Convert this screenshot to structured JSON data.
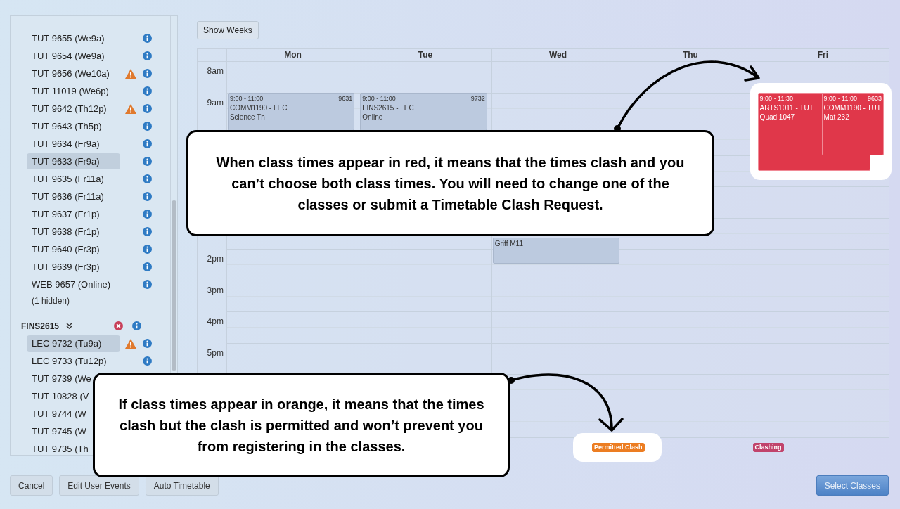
{
  "sidebar": {
    "items": [
      {
        "kind": "class",
        "label": "TUT 9655 (We9a)",
        "warning": false,
        "selected": false
      },
      {
        "kind": "class",
        "label": "TUT 9654 (We9a)",
        "warning": false,
        "selected": false
      },
      {
        "kind": "class",
        "label": "TUT 9656 (We10a)",
        "warning": true,
        "selected": false
      },
      {
        "kind": "class",
        "label": "TUT 11019 (We6p)",
        "warning": false,
        "selected": false
      },
      {
        "kind": "class",
        "label": "TUT 9642 (Th12p)",
        "warning": true,
        "selected": false
      },
      {
        "kind": "class",
        "label": "TUT 9643 (Th5p)",
        "warning": false,
        "selected": false
      },
      {
        "kind": "class",
        "label": "TUT 9634 (Fr9a)",
        "warning": false,
        "selected": false
      },
      {
        "kind": "class",
        "label": "TUT 9633 (Fr9a)",
        "warning": false,
        "selected": true
      },
      {
        "kind": "class",
        "label": "TUT 9635 (Fr11a)",
        "warning": false,
        "selected": false
      },
      {
        "kind": "class",
        "label": "TUT 9636 (Fr11a)",
        "warning": false,
        "selected": false
      },
      {
        "kind": "class",
        "label": "TUT 9637 (Fr1p)",
        "warning": false,
        "selected": false
      },
      {
        "kind": "class",
        "label": "TUT 9638 (Fr1p)",
        "warning": false,
        "selected": false
      },
      {
        "kind": "class",
        "label": "TUT 9640 (Fr3p)",
        "warning": false,
        "selected": false
      },
      {
        "kind": "class",
        "label": "TUT 9639 (Fr3p)",
        "warning": false,
        "selected": false
      },
      {
        "kind": "class",
        "label": "WEB 9657 (Online)",
        "warning": false,
        "selected": false
      },
      {
        "kind": "note",
        "label": "(1 hidden)"
      },
      {
        "kind": "course",
        "label": "FINS2615",
        "error": true
      },
      {
        "kind": "class",
        "label": "LEC 9732 (Tu9a)",
        "warning": true,
        "selected": true
      },
      {
        "kind": "class",
        "label": "LEC 9733 (Tu12p)",
        "warning": false,
        "selected": false
      },
      {
        "kind": "covered",
        "label": "TUT 9739 (We"
      },
      {
        "kind": "covered",
        "label": "TUT 10828 (V"
      },
      {
        "kind": "covered",
        "label": "TUT 9744 (W"
      },
      {
        "kind": "covered",
        "label": "TUT 9745 (W"
      },
      {
        "kind": "covered",
        "label": "TUT 9735 (Th"
      }
    ]
  },
  "show_weeks_button": "Show Weeks",
  "calendar": {
    "time_rows": [
      "8am",
      "9am",
      null,
      null,
      null,
      null,
      "2pm",
      "3pm",
      "4pm",
      "5pm",
      null,
      null
    ],
    "days": [
      {
        "name": "Mon",
        "highlight": false,
        "events": [
          {
            "time": "9:00 - 11:00",
            "number": "9631",
            "title": "COMM1190 - LEC",
            "location": "Science Th",
            "clash": false
          }
        ]
      },
      {
        "name": "Tue",
        "highlight": false,
        "events": [
          {
            "time": "9:00 - 11:00",
            "number": "9732",
            "title": "FINS2615 - LEC",
            "location": "Online",
            "clash": false
          }
        ]
      },
      {
        "name": "Wed",
        "highlight": false,
        "events": [
          {
            "location": "Griff M11",
            "clash": false
          }
        ]
      },
      {
        "name": "Thu",
        "highlight": false
      },
      {
        "name": "Fri",
        "highlight": true,
        "events": [
          {
            "time": "9:00 - 11:30",
            "title": "ARTS1011 - TUT",
            "location": "Quad 1047",
            "clash": true
          },
          {
            "time": "9:00 - 11:00",
            "number": "9633",
            "title": "COMM1190 - TUT",
            "location": "Mat 232",
            "clash": true
          }
        ]
      }
    ]
  },
  "legend": [
    {
      "kind": "permitted",
      "label": "Permitted Clash",
      "highlighted": true
    },
    {
      "kind": "clashing",
      "label": "Clashing",
      "highlighted": false
    }
  ],
  "buttons": [
    {
      "label": "Cancel",
      "primary": false
    },
    {
      "label": "Edit User Events",
      "primary": false
    },
    {
      "label": "Auto Timetable",
      "primary": false
    },
    {
      "label": "Select Classes",
      "primary": true
    }
  ],
  "annotations": [
    {
      "text": "When class times appear in red, it means that the times clash and you can’t choose both class times. You will need to change one of the classes or submit a Timetable Clash Request."
    },
    {
      "text": "If class times appear in orange, it means that the times clash but the clash is permitted and won’t prevent you from registering in the classes."
    }
  ]
}
